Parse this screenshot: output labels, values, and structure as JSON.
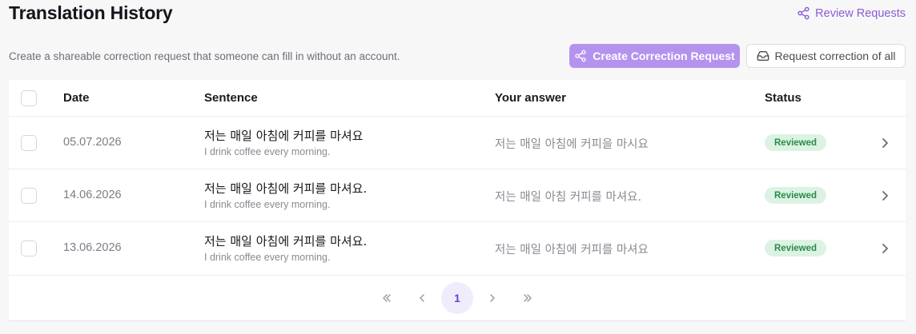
{
  "header": {
    "title": "Translation History",
    "review_link": "Review Requests"
  },
  "toolbar": {
    "subtitle": "Create a shareable correction request that someone can fill in without an account.",
    "create_button": "Create Correction Request",
    "request_all_button": "Request correction of all"
  },
  "table": {
    "columns": {
      "date": "Date",
      "sentence": "Sentence",
      "answer": "Your answer",
      "status": "Status"
    },
    "rows": [
      {
        "date": "05.07.2026",
        "sentence": "저는 매일 아침에 커피를 마셔요",
        "translation": "I drink coffee every morning.",
        "answer": "저는 매일 아침에 커피을 마시요",
        "status": "Reviewed"
      },
      {
        "date": "14.06.2026",
        "sentence": "저는 매일 아침에 커피를 마셔요.",
        "translation": "I drink coffee every morning.",
        "answer": "저는 매일 아침 커피를 마셔요.",
        "status": "Reviewed"
      },
      {
        "date": "13.06.2026",
        "sentence": "저는 매일 아침에 커피를 마셔요.",
        "translation": "I drink coffee every morning.",
        "answer": "저는 매일 아침에 커피를 마셔요",
        "status": "Reviewed"
      }
    ]
  },
  "pagination": {
    "current_page": "1"
  },
  "colors": {
    "accent": "#8b5cd6",
    "primary_button": "#b493ef",
    "reviewed_badge_bg": "#dcf3e3",
    "reviewed_badge_text": "#2a8a4b"
  }
}
